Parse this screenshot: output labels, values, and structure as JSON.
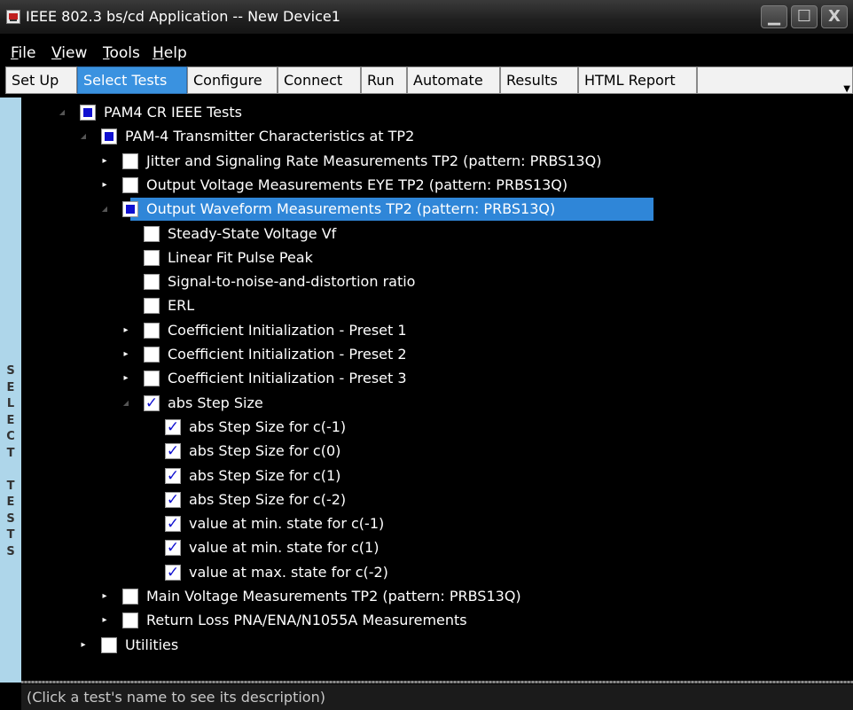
{
  "window": {
    "title": "IEEE 802.3 bs/cd Application -- New Device1"
  },
  "menu": [
    "File",
    "View",
    "Tools",
    "Help"
  ],
  "tabs": [
    {
      "label": "Set Up"
    },
    {
      "label": "Select Tests"
    },
    {
      "label": "Configure"
    },
    {
      "label": "Connect"
    },
    {
      "label": "Run"
    },
    {
      "label": "Automate"
    },
    {
      "label": "Results"
    },
    {
      "label": "HTML Report"
    }
  ],
  "active_tab": "Select Tests",
  "side_label": "SELECT TESTS",
  "tree": [
    {
      "label": "PAM4 CR IEEE Tests",
      "level": 0,
      "expander": "open",
      "check": "partial"
    },
    {
      "label": "PAM-4 Transmitter Characteristics at TP2",
      "level": 1,
      "expander": "open",
      "check": "partial"
    },
    {
      "label": "Jitter and Signaling Rate Measurements TP2 (pattern: PRBS13Q)",
      "level": 2,
      "expander": "closed",
      "check": "unchecked"
    },
    {
      "label": "Output Voltage Measurements EYE TP2 (pattern: PRBS13Q)",
      "level": 2,
      "expander": "closed",
      "check": "unchecked"
    },
    {
      "label": "Output Waveform Measurements TP2 (pattern: PRBS13Q)",
      "level": 2,
      "expander": "open",
      "check": "partial",
      "selected": true
    },
    {
      "label": "Steady-State Voltage Vf",
      "level": 3,
      "expander": "none",
      "check": "unchecked"
    },
    {
      "label": "Linear Fit Pulse Peak",
      "level": 3,
      "expander": "none",
      "check": "unchecked"
    },
    {
      "label": "Signal-to-noise-and-distortion ratio",
      "level": 3,
      "expander": "none",
      "check": "unchecked"
    },
    {
      "label": "ERL",
      "level": 3,
      "expander": "none",
      "check": "unchecked"
    },
    {
      "label": "Coefficient Initialization - Preset 1",
      "level": 3,
      "expander": "closed",
      "check": "unchecked"
    },
    {
      "label": "Coefficient Initialization - Preset 2",
      "level": 3,
      "expander": "closed",
      "check": "unchecked"
    },
    {
      "label": "Coefficient Initialization - Preset 3",
      "level": 3,
      "expander": "closed",
      "check": "unchecked"
    },
    {
      "label": "abs Step Size",
      "level": 3,
      "expander": "open",
      "check": "checked"
    },
    {
      "label": "abs Step Size for c(-1)",
      "level": 4,
      "expander": "none",
      "check": "checked"
    },
    {
      "label": "abs Step Size for c(0)",
      "level": 4,
      "expander": "none",
      "check": "checked"
    },
    {
      "label": "abs Step Size for c(1)",
      "level": 4,
      "expander": "none",
      "check": "checked"
    },
    {
      "label": "abs Step Size for c(-2)",
      "level": 4,
      "expander": "none",
      "check": "checked"
    },
    {
      "label": "value at min. state for c(-1)",
      "level": 4,
      "expander": "none",
      "check": "checked"
    },
    {
      "label": "value at min. state for c(1)",
      "level": 4,
      "expander": "none",
      "check": "checked"
    },
    {
      "label": "value at max. state for c(-2)",
      "level": 4,
      "expander": "none",
      "check": "checked"
    },
    {
      "label": "Main Voltage Measurements TP2 (pattern: PRBS13Q)",
      "level": 2,
      "expander": "closed",
      "check": "unchecked"
    },
    {
      "label": "Return Loss PNA/ENA/N1055A Measurements",
      "level": 2,
      "expander": "closed",
      "check": "unchecked"
    },
    {
      "label": "Utilities",
      "level": 1,
      "expander": "closed",
      "check": "unchecked"
    }
  ],
  "status": "(Click a test's name to see its description)",
  "colors": {
    "accent": "#2f86d8",
    "partial_fill": "#1010d0",
    "sidebar": "#aed6ea"
  }
}
